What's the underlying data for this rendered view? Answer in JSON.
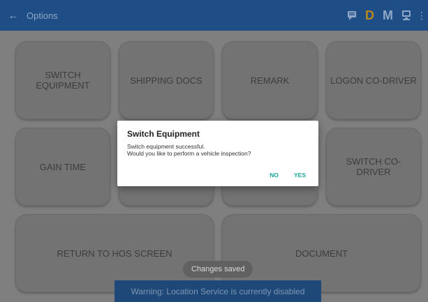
{
  "appbar": {
    "back_icon": "arrow-left-icon",
    "title": "Options",
    "actions": [
      {
        "name": "message-icon",
        "type": "icon"
      },
      {
        "name": "duty-status-d",
        "label": "D",
        "color": "#b8861a"
      },
      {
        "name": "mode-m",
        "label": "M"
      },
      {
        "name": "device-icon",
        "type": "icon"
      },
      {
        "name": "overflow-menu-icon",
        "glyph": "⋮"
      }
    ]
  },
  "tiles": [
    {
      "id": "switch-equipment",
      "label": "SWITCH\nEQUIPMENT"
    },
    {
      "id": "shipping-docs",
      "label": "SHIPPING DOCS"
    },
    {
      "id": "remark",
      "label": "REMARK"
    },
    {
      "id": "logon-co-driver",
      "label": "LOGON CO-DRIVER"
    },
    {
      "id": "gain-time",
      "label": "GAIN TIME"
    },
    {
      "id": "hidden-2",
      "label": ""
    },
    {
      "id": "hidden-3",
      "label": ""
    },
    {
      "id": "switch-co-driver",
      "label": "SWITCH CO-\nDRIVER"
    },
    {
      "id": "return-to-hos",
      "label": "RETURN TO HOS SCREEN"
    },
    {
      "id": "document",
      "label": "DOCUMENT"
    }
  ],
  "dialog": {
    "title": "Switch Equipment",
    "message_line1": "Switch equipment successful.",
    "message_line2": "Would you like to perform a vehicle inspection?",
    "no_label": "NO",
    "yes_label": "YES",
    "accent_color": "#1aa59a"
  },
  "toast": {
    "text": "Changes saved"
  },
  "warning": {
    "text": "Warning: Location Service is currently disabled"
  }
}
